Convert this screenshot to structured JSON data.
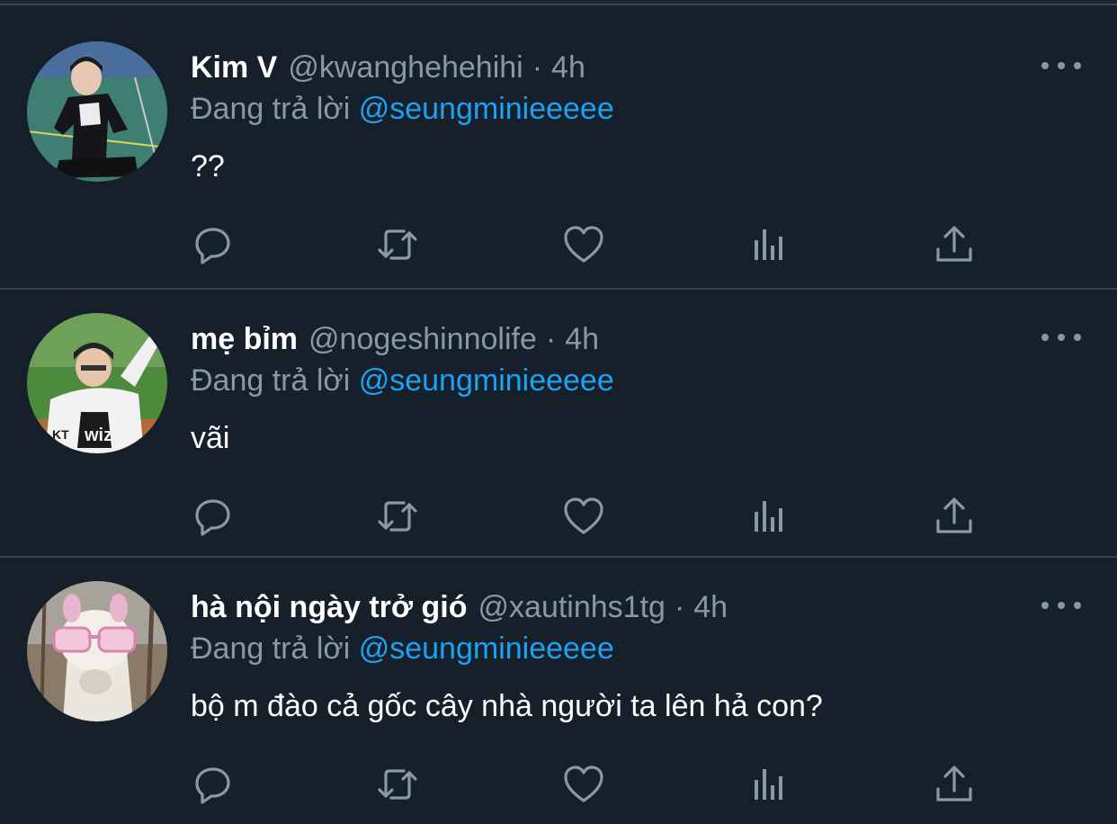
{
  "reply_prefix": "Đang trả lời",
  "colors": {
    "background": "#15202b",
    "muted": "#8899a6",
    "accent": "#1da1f2",
    "divider": "#38444d"
  },
  "action_icons": [
    "reply-icon",
    "retweet-icon",
    "like-icon",
    "analytics-icon",
    "share-icon"
  ],
  "tweets": [
    {
      "name": "Kim V",
      "handle": "@kwanghehehihi",
      "separator": "·",
      "time": "4h",
      "mention": "@seungminieeeee",
      "text": "??"
    },
    {
      "name": "mẹ bỉm",
      "handle": "@nogeshinnolife",
      "separator": "·",
      "time": "4h",
      "mention": "@seungminieeeee",
      "text": "vãi"
    },
    {
      "name": "hà nội ngày trở gió",
      "handle": "@xautinhs1tg",
      "separator": "·",
      "time": "4h",
      "mention": "@seungminieeeee",
      "text": "bộ m đào cả gốc cây nhà người ta lên hả con?"
    }
  ]
}
